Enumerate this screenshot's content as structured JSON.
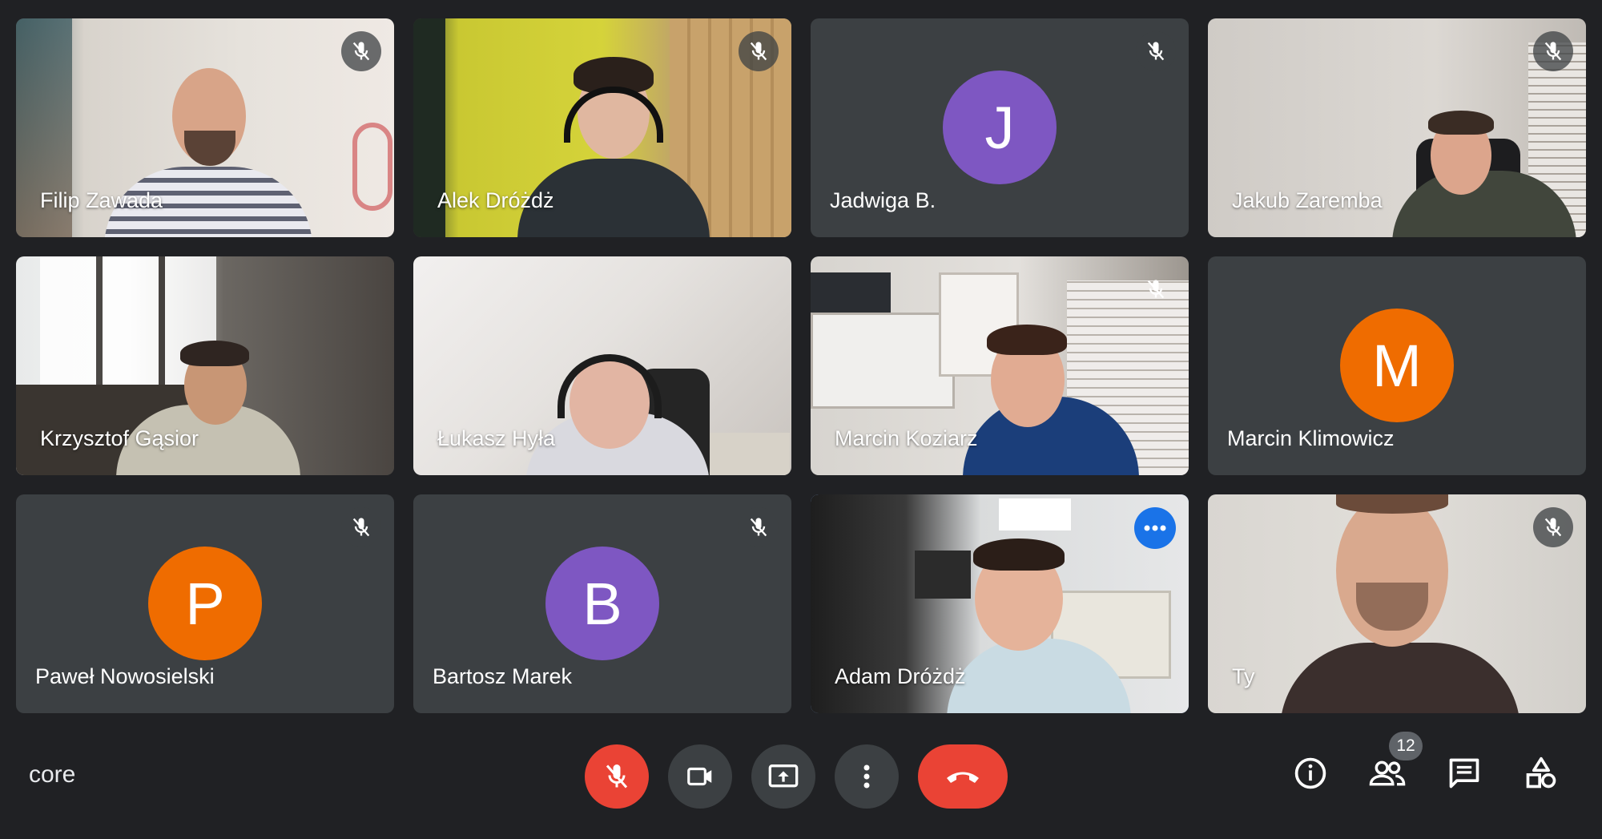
{
  "participants": [
    {
      "name": "Filip Zawada",
      "type": "video",
      "muted": true
    },
    {
      "name": "Alek Dróżdż",
      "type": "video",
      "muted": true
    },
    {
      "name": "Jadwiga B.",
      "type": "avatar",
      "initial": "J",
      "avatar_color": "#7e57c2",
      "muted": true
    },
    {
      "name": "Jakub Zaremba",
      "type": "video",
      "muted": true
    },
    {
      "name": "Krzysztof Gąsior",
      "type": "video",
      "muted": false
    },
    {
      "name": "Łukasz Hyła",
      "type": "video",
      "muted": false
    },
    {
      "name": "Marcin Koziarz",
      "type": "video",
      "muted": true
    },
    {
      "name": "Marcin Klimowicz",
      "type": "avatar",
      "initial": "M",
      "avatar_color": "#ef6c00",
      "muted": false
    },
    {
      "name": "Paweł Nowosielski",
      "type": "avatar",
      "initial": "P",
      "avatar_color": "#ef6c00",
      "muted": true
    },
    {
      "name": "Bartosz Marek",
      "type": "avatar",
      "initial": "B",
      "avatar_color": "#7e57c2",
      "muted": true
    },
    {
      "name": "Adam Dróżdż",
      "type": "video",
      "muted": false,
      "active_speaker": true,
      "accent": "#8ab4f8"
    },
    {
      "name": "Ty",
      "type": "video",
      "muted": true
    }
  ],
  "meeting": {
    "name": "core"
  },
  "controls": {
    "mic": {
      "icon": "mic-off-icon",
      "color": "#ea4335"
    },
    "camera": {
      "icon": "videocam-icon"
    },
    "present": {
      "icon": "present-screen-icon"
    },
    "more": {
      "icon": "more-vert-icon"
    },
    "end_call": {
      "icon": "call-end-icon",
      "color": "#ea4335"
    }
  },
  "right_controls": {
    "info": {
      "icon": "info-icon"
    },
    "people": {
      "icon": "people-icon",
      "count": "12"
    },
    "chat": {
      "icon": "chat-icon"
    },
    "activities": {
      "icon": "activities-icon"
    }
  }
}
